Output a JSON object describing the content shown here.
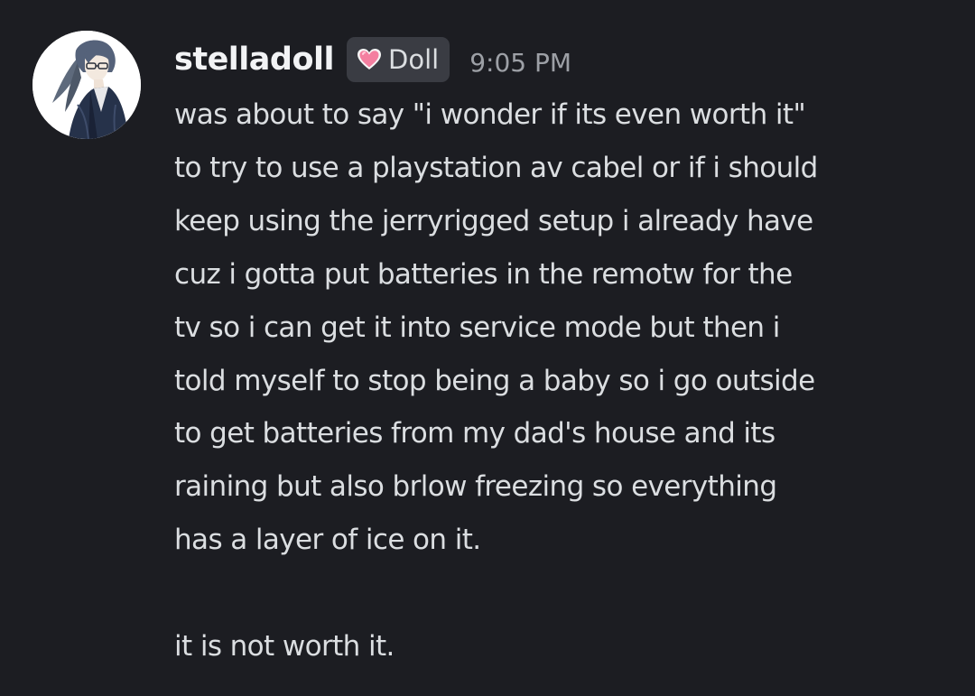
{
  "message": {
    "author": {
      "username": "stelladoll",
      "tag_label": "Doll",
      "tag_icon": "heart-icon",
      "tag_icon_color": "#f47fa0",
      "avatar": "anime-character-avatar"
    },
    "timestamp": "9:05 PM",
    "paragraph_1_lines": [
      "was about to say \"i wonder if its even worth it\"",
      "to try to use a playstation av cabel or if i should",
      "keep using the jerryrigged setup i already have",
      "cuz i gotta put batteries in the remotw for the",
      "tv so i can get it into service mode but then i",
      "told myself to stop being a baby so i go outside",
      "to get batteries from my dad's house and its",
      "raining but also brlow freezing so everything",
      "has a layer of ice on it."
    ],
    "paragraph_2": "it is not worth it."
  },
  "colors": {
    "background": "#1c1d22",
    "username": "#f2f3f5",
    "text": "#dbdee1",
    "timestamp": "#9da0a6",
    "tag_background": "#3a3c43"
  }
}
